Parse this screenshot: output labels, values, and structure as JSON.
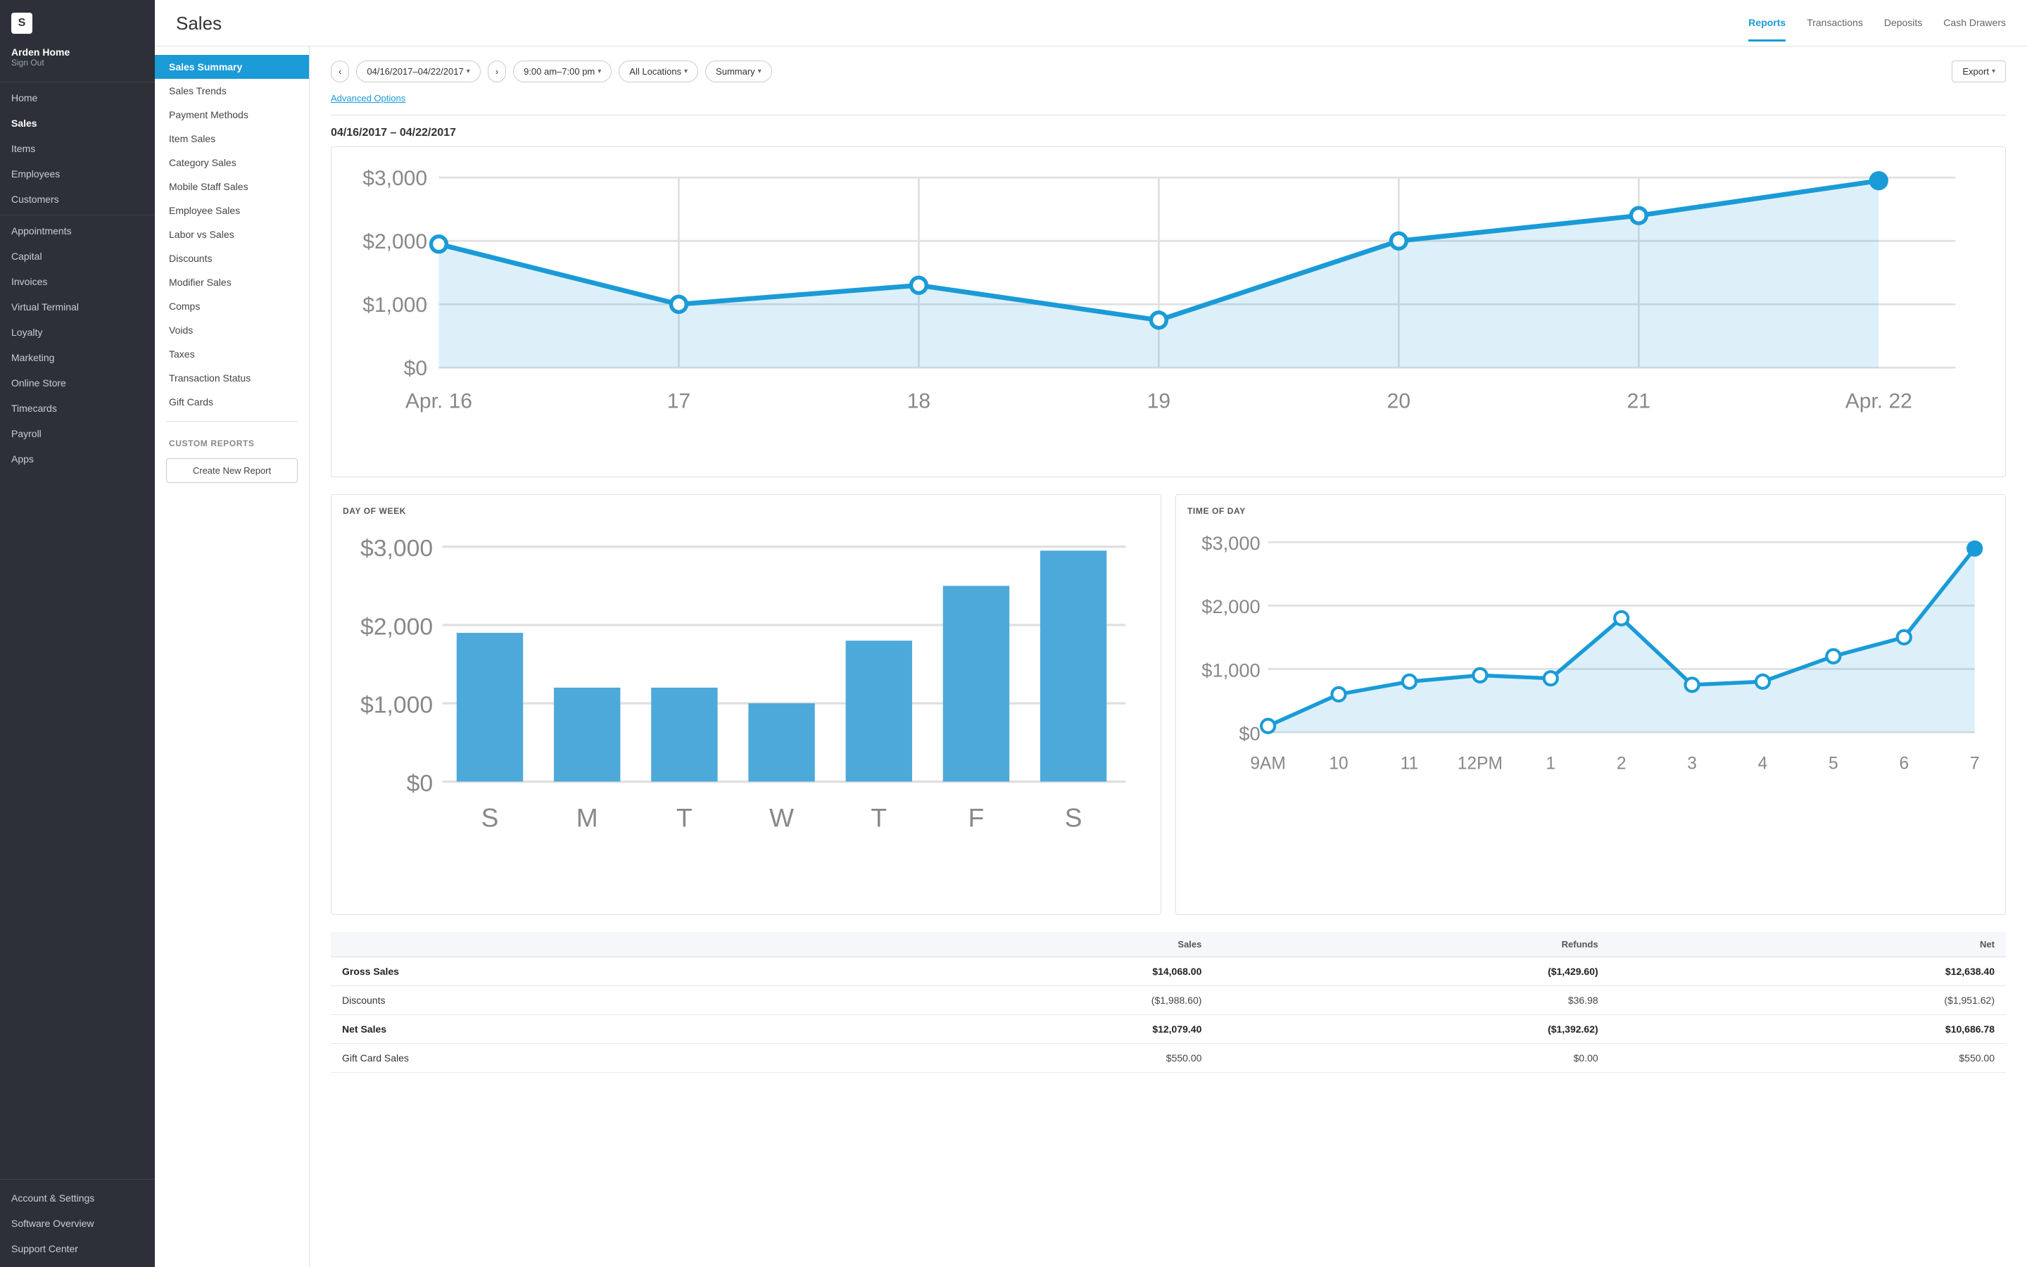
{
  "sidebar": {
    "logo": "S",
    "user": {
      "name": "Arden Home",
      "sign_out": "Sign Out"
    },
    "items": [
      {
        "id": "home",
        "label": "Home"
      },
      {
        "id": "sales",
        "label": "Sales",
        "active": true
      },
      {
        "id": "items",
        "label": "Items"
      },
      {
        "id": "employees",
        "label": "Employees"
      },
      {
        "id": "customers",
        "label": "Customers"
      }
    ],
    "items2": [
      {
        "id": "appointments",
        "label": "Appointments"
      },
      {
        "id": "capital",
        "label": "Capital"
      },
      {
        "id": "invoices",
        "label": "Invoices"
      },
      {
        "id": "virtual-terminal",
        "label": "Virtual Terminal"
      },
      {
        "id": "loyalty",
        "label": "Loyalty"
      },
      {
        "id": "marketing",
        "label": "Marketing"
      },
      {
        "id": "online-store",
        "label": "Online Store"
      },
      {
        "id": "timecards",
        "label": "Timecards"
      },
      {
        "id": "payroll",
        "label": "Payroll"
      },
      {
        "id": "apps",
        "label": "Apps"
      }
    ],
    "bottom": [
      {
        "id": "account-settings",
        "label": "Account & Settings"
      },
      {
        "id": "software-overview",
        "label": "Software Overview"
      },
      {
        "id": "support-center",
        "label": "Support Center"
      }
    ]
  },
  "header": {
    "title": "Sales",
    "nav": [
      {
        "id": "reports",
        "label": "Reports",
        "active": true
      },
      {
        "id": "transactions",
        "label": "Transactions"
      },
      {
        "id": "deposits",
        "label": "Deposits"
      },
      {
        "id": "cash-drawers",
        "label": "Cash Drawers"
      }
    ]
  },
  "left_nav": {
    "items": [
      {
        "id": "sales-summary",
        "label": "Sales Summary",
        "active": true
      },
      {
        "id": "sales-trends",
        "label": "Sales Trends"
      },
      {
        "id": "payment-methods",
        "label": "Payment Methods"
      },
      {
        "id": "item-sales",
        "label": "Item Sales"
      },
      {
        "id": "category-sales",
        "label": "Category Sales"
      },
      {
        "id": "mobile-staff-sales",
        "label": "Mobile Staff Sales"
      },
      {
        "id": "employee-sales",
        "label": "Employee Sales"
      },
      {
        "id": "labor-vs-sales",
        "label": "Labor vs Sales"
      },
      {
        "id": "discounts",
        "label": "Discounts"
      },
      {
        "id": "modifier-sales",
        "label": "Modifier Sales"
      },
      {
        "id": "comps",
        "label": "Comps"
      },
      {
        "id": "voids",
        "label": "Voids"
      },
      {
        "id": "taxes",
        "label": "Taxes"
      },
      {
        "id": "transaction-status",
        "label": "Transaction Status"
      },
      {
        "id": "gift-cards",
        "label": "Gift Cards"
      }
    ],
    "custom_reports_label": "CUSTOM REPORTS",
    "create_new_report": "Create New Report"
  },
  "toolbar": {
    "prev_label": "‹",
    "next_label": "›",
    "date_range": "04/16/2017–04/22/2017",
    "time_range": "9:00 am–7:00 pm",
    "locations": "All Locations",
    "summary": "Summary",
    "export": "Export",
    "advanced_options": "Advanced Options"
  },
  "report": {
    "date_range_header": "04/16/2017 – 04/22/2017",
    "main_chart": {
      "x_labels": [
        "Apr. 16",
        "17",
        "18",
        "19",
        "20",
        "21",
        "Apr. 22"
      ],
      "y_labels": [
        "$3,000",
        "$2,000",
        "$1,000",
        "$0"
      ],
      "data_points": [
        1950,
        1000,
        1300,
        750,
        2000,
        2400,
        2950
      ]
    },
    "day_of_week_chart": {
      "title": "DAY OF WEEK",
      "labels": [
        "S",
        "M",
        "T",
        "W",
        "T",
        "F",
        "S"
      ],
      "values": [
        1900,
        1200,
        1200,
        1000,
        1800,
        2500,
        2950
      ]
    },
    "time_of_day_chart": {
      "title": "TIME OF DAY",
      "x_labels": [
        "9AM",
        "10",
        "11",
        "12PM",
        "1",
        "2",
        "3",
        "4",
        "5",
        "6",
        "7"
      ],
      "data_points": [
        100,
        600,
        800,
        900,
        850,
        1800,
        750,
        800,
        1200,
        1500,
        2900
      ]
    },
    "table": {
      "headers": [
        "",
        "Sales",
        "Refunds",
        "Net"
      ],
      "rows": [
        {
          "label": "Gross Sales",
          "sales": "$14,068.00",
          "refunds": "($1,429.60)",
          "net": "$12,638.40",
          "bold": true
        },
        {
          "label": "Discounts",
          "sales": "($1,988.60)",
          "refunds": "$36.98",
          "net": "($1,951.62)",
          "bold": false
        },
        {
          "label": "Net Sales",
          "sales": "$12,079.40",
          "refunds": "($1,392.62)",
          "net": "$10,686.78",
          "bold": true
        },
        {
          "label": "Gift Card Sales",
          "sales": "$550.00",
          "refunds": "$0.00",
          "net": "$550.00",
          "bold": false
        }
      ]
    }
  },
  "colors": {
    "sidebar_bg": "#2d3038",
    "active_nav": "#1a9bd7",
    "chart_line": "#1a9bd7",
    "chart_fill": "rgba(26, 155, 215, 0.15)",
    "bar_fill": "#4da9d9"
  }
}
